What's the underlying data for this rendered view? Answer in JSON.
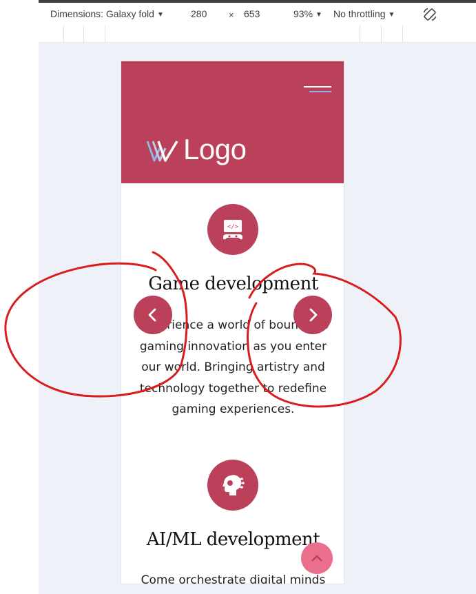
{
  "devtools": {
    "dimensions_label": "Dimensions: Galaxy fold",
    "width": "280",
    "times": "×",
    "height": "653",
    "zoom": "93%",
    "throttling": "No throttling",
    "rotate_icon": "rotate-icon"
  },
  "site": {
    "logo_text": "Logo",
    "menu_icon": "hamburger-icon",
    "services": [
      {
        "icon": "game-controller-code-icon",
        "title": "Game development",
        "description": "Experience a world of boundless gaming innovation as you enter our world. Bringing artistry and technology together to redefine gaming experiences."
      },
      {
        "icon": "ai-brain-circuit-icon",
        "title": "AI/ML development",
        "description": "Come orchestrate digital minds"
      }
    ],
    "carousel": {
      "prev_icon": "chevron-left-icon",
      "next_icon": "chevron-right-icon"
    },
    "scroll_top_icon": "chevron-up-icon"
  },
  "colors": {
    "brand": "#bb405a",
    "scroll_top": "#ea6f8d",
    "annotation": "#d91c1c",
    "viewport_bg": "#eef1f8"
  }
}
